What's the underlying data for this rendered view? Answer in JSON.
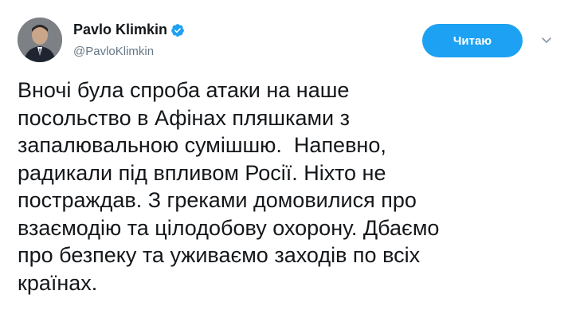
{
  "user": {
    "display_name": "Pavlo Klimkin",
    "handle": "@PavloKlimkin",
    "verified": true
  },
  "follow_button": {
    "label": "Читаю"
  },
  "tweet": {
    "text": "Вночі була спроба атаки на наше\nпосольство в Афінах пляшками з\nзапалювальною сумішшю.  Напевно,\nрадикали під впливом Росії. Ніхто не\nпостраждав. З греками домовилися про\nвзаємодію та цілодобову охорону. Дбаємо\nпро безпеку та уживаємо заходів по всіх\nкраїнах."
  },
  "icons": {
    "verified": "verified-badge-icon",
    "more": "chevron-down-icon"
  },
  "colors": {
    "accent": "#1da1f2",
    "handle": "#657786",
    "text": "#14171a"
  }
}
